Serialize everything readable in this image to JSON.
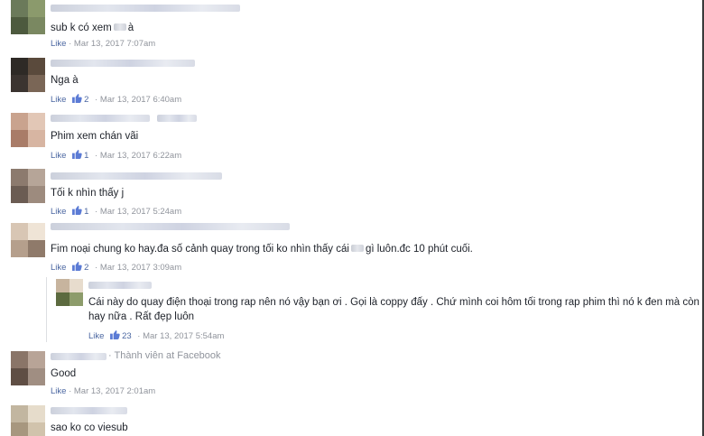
{
  "comments": [
    {
      "text": "sub k có xem",
      "text_tail": "à",
      "like": "Like",
      "reactions": "",
      "sep": "·",
      "time": "Mar 13, 2017 7:07am"
    },
    {
      "text": "Nga à",
      "like": "Like",
      "reactions": "2",
      "sep": "·",
      "time": "Mar 13, 2017 6:40am"
    },
    {
      "text": "Phim xem chán vãi",
      "like": "Like",
      "reactions": "1",
      "sep": "·",
      "time": "Mar 13, 2017 6:22am"
    },
    {
      "text": "Tối k nhìn thấy j",
      "like": "Like",
      "reactions": "1",
      "sep": "·",
      "time": "Mar 13, 2017 5:24am"
    },
    {
      "text": "Fim noại chung ko hay.đa số cảnh quay trong tối ko nhìn thấy cái",
      "text_tail": "gì luôn.đc 10 phút cuối.",
      "like": "Like",
      "reactions": "2",
      "sep": "·",
      "time": "Mar 13, 2017 3:09am"
    },
    {
      "text": "Good",
      "badge": "· Thành viên at Facebook",
      "like": "Like",
      "reactions": "",
      "sep": "·",
      "time": "Mar 13, 2017 2:01am"
    },
    {
      "text": "sao ko co viesub"
    }
  ],
  "reply": {
    "line1": "Cái này do quay điện thoại trong rap nên nó vậy bạn ơi . Gọi là coppy đấy . Chứ mình coi hôm tối trong rap phim thì nó k đen mà còn",
    "line2": "hay nữa . Rất đẹp luôn",
    "like": "Like",
    "reactions": "23",
    "sep": "·",
    "time": "Mar 13, 2017 5:54am"
  },
  "colors": {
    "link": "#4b67a1",
    "meta": "#90949c",
    "text": "#1d2129"
  },
  "icons": {
    "reaction": "thumbs-up-icon"
  }
}
